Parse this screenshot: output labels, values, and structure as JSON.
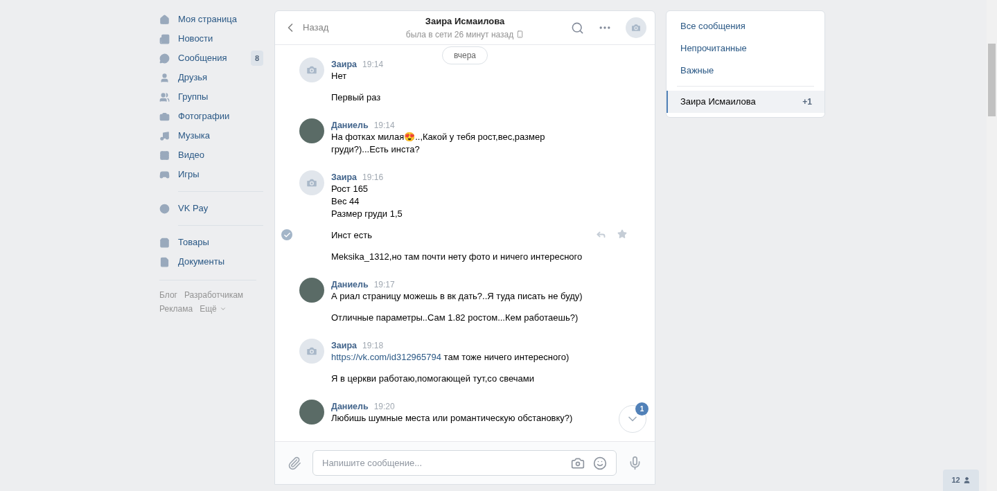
{
  "nav": {
    "groups": [
      [
        {
          "label": "Моя страница"
        },
        {
          "label": "Новости"
        },
        {
          "label": "Сообщения",
          "badge": "8"
        },
        {
          "label": "Друзья"
        },
        {
          "label": "Группы"
        },
        {
          "label": "Фотографии"
        },
        {
          "label": "Музыка"
        },
        {
          "label": "Видео"
        },
        {
          "label": "Игры"
        }
      ],
      [
        {
          "label": "VK Pay"
        }
      ],
      [
        {
          "label": "Товары"
        },
        {
          "label": "Документы"
        }
      ]
    ],
    "footer_links": [
      "Блог",
      "Разработчикам",
      "Реклама",
      "Ещё"
    ]
  },
  "chat": {
    "back": "Назад",
    "title": "Заира Исмаилова",
    "status": "была в сети 26 минут назад",
    "date_divider": "вчера",
    "groups": [
      {
        "kind": "camera",
        "author": "Заира",
        "time": "19:14",
        "messages": [
          {
            "lines": [
              "Нет"
            ],
            "selected": false
          },
          {
            "lines": [
              "Первый раз"
            ],
            "selected": false
          }
        ]
      },
      {
        "kind": "photo",
        "author": "Даниель",
        "time": "19:14",
        "messages": [
          {
            "lines": [
              "На фотках милая😍..,Какой у тебя рост,вес,размер груди?)...Есть инста?"
            ],
            "selected": false
          }
        ]
      },
      {
        "kind": "camera",
        "author": "Заира",
        "time": "19:16",
        "messages": [
          {
            "lines": [
              "Рост 165",
              "Вес 44",
              "Размер груди 1,5"
            ],
            "selected": false
          },
          {
            "lines": [
              "Инст есть"
            ],
            "selected": true
          },
          {
            "lines": [
              "Meksika_1312,но там почти нету фото и ничего интересного"
            ],
            "selected": false
          }
        ]
      },
      {
        "kind": "photo",
        "author": "Даниель",
        "time": "19:17",
        "messages": [
          {
            "lines": [
              "А риал страницу можешь в вк дать?..Я туда писать не буду)"
            ],
            "selected": false
          },
          {
            "lines": [
              "Отличные параметры..Сам 1.82 ростом...Кем работаешь?)"
            ],
            "selected": false
          }
        ]
      },
      {
        "kind": "camera",
        "author": "Заира",
        "time": "19:18",
        "messages": [
          {
            "link": "https://vk.com/id312965794",
            "lines": [
              " там тоже ничего интересного)"
            ],
            "selected": false
          },
          {
            "lines": [
              "Я в церкви работаю,помогающей тут,со свечами"
            ],
            "selected": false
          }
        ]
      },
      {
        "kind": "photo",
        "author": "Даниель",
        "time": "19:20",
        "messages": [
          {
            "lines": [
              "Любишь шумные места или романтическую обстановку?)"
            ],
            "selected": false
          }
        ]
      }
    ],
    "unread_badge": "1",
    "composer": {
      "placeholder": "Напишите сообщение..."
    }
  },
  "filters": [
    {
      "label": "Все сообщения"
    },
    {
      "label": "Непрочитанные"
    },
    {
      "label": "Важные"
    }
  ],
  "conversations": [
    {
      "name": "Заира Исмаилова",
      "count": "+1",
      "selected": true
    }
  ],
  "online_count": "12"
}
